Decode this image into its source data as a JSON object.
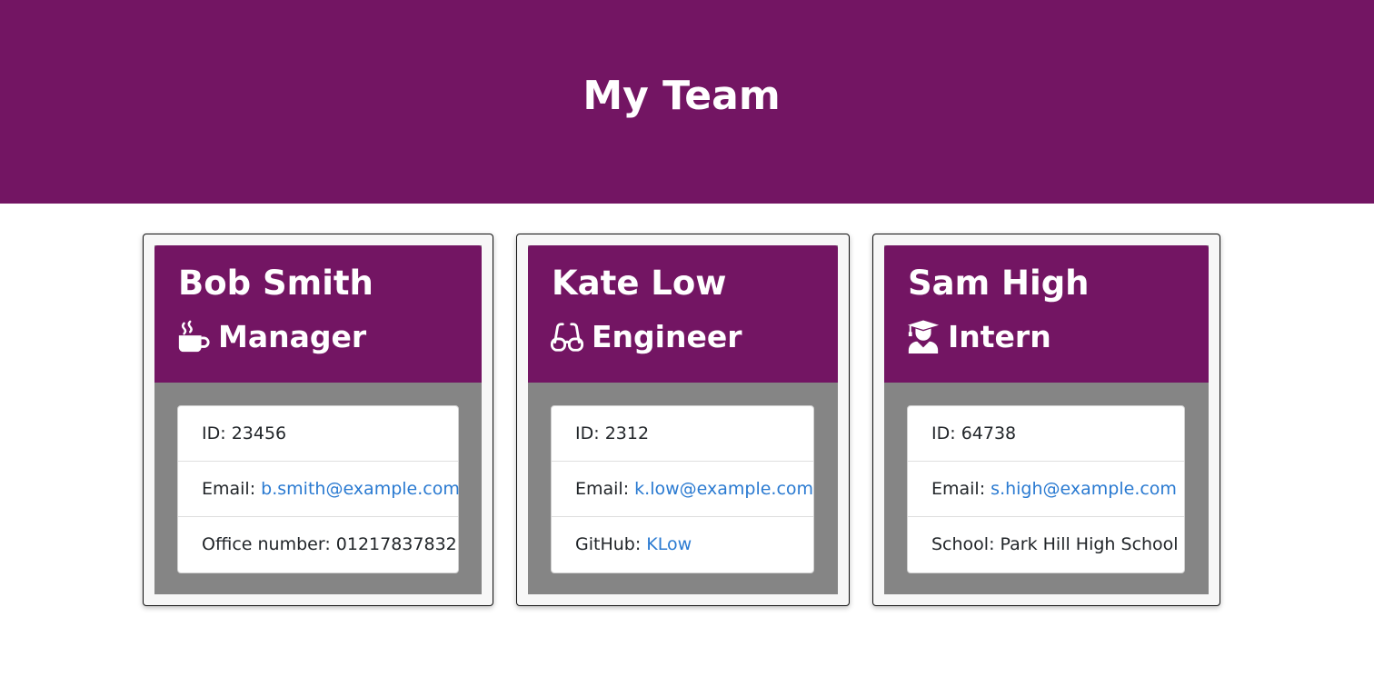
{
  "page": {
    "title": "My Team"
  },
  "colors": {
    "header_bg": "#731563",
    "card_body_bg": "#858585",
    "link": "#2a7ad1"
  },
  "team": [
    {
      "name": "Bob Smith",
      "role": "Manager",
      "role_icon": "coffee-mug-icon",
      "id_label": "ID:",
      "id": "23456",
      "email_label": "Email:",
      "email": "b.smith@example.com",
      "extra_label": "Office number:",
      "extra": "01217837832"
    },
    {
      "name": "Kate Low",
      "role": "Engineer",
      "role_icon": "glasses-icon",
      "id_label": "ID:",
      "id": "2312",
      "email_label": "Email:",
      "email": "k.low@example.com",
      "extra_label": "GitHub:",
      "extra": "KLow"
    },
    {
      "name": "Sam High",
      "role": "Intern",
      "role_icon": "graduate-icon",
      "id_label": "ID:",
      "id": "64738",
      "email_label": "Email:",
      "email": "s.high@example.com",
      "extra_label": "School:",
      "extra": "Park Hill High School"
    }
  ]
}
